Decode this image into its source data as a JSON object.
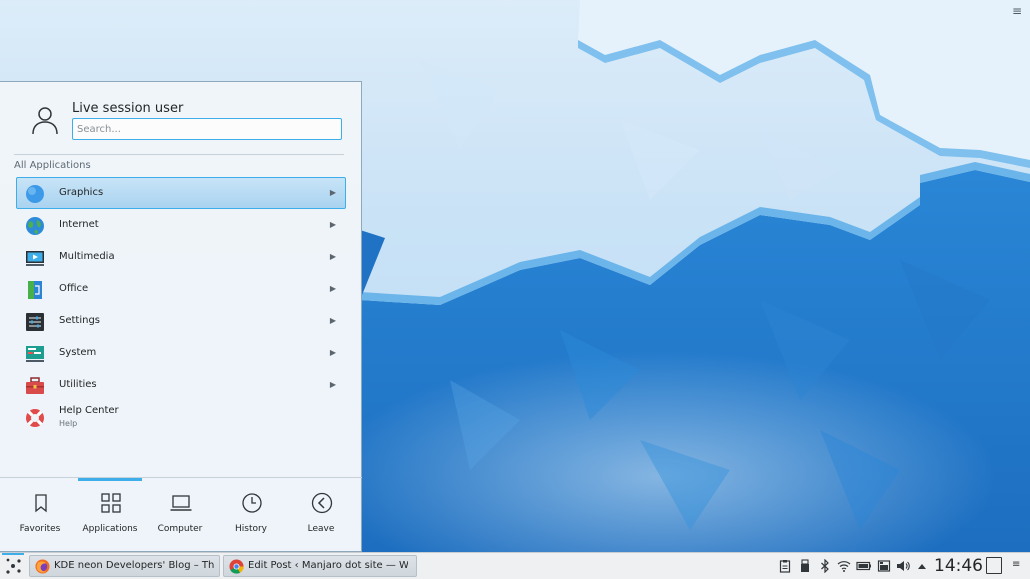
{
  "launcher": {
    "user_name": "Live session user",
    "search_placeholder": "Search...",
    "section_title": "All Applications",
    "apps": [
      {
        "label": "Graphics",
        "icon": "graphics-icon",
        "has_submenu": true,
        "selected": true
      },
      {
        "label": "Internet",
        "icon": "internet-globe-icon",
        "has_submenu": true
      },
      {
        "label": "Multimedia",
        "icon": "multimedia-icon",
        "has_submenu": true
      },
      {
        "label": "Office",
        "icon": "office-icon",
        "has_submenu": true
      },
      {
        "label": "Settings",
        "icon": "settings-sliders-icon",
        "has_submenu": true
      },
      {
        "label": "System",
        "icon": "system-monitor-icon",
        "has_submenu": true
      },
      {
        "label": "Utilities",
        "icon": "toolbox-icon",
        "has_submenu": true
      },
      {
        "label": "Help Center",
        "sublabel": "Help",
        "icon": "lifebuoy-icon",
        "has_submenu": false
      }
    ],
    "tabs": [
      {
        "label": "Favorites",
        "icon": "bookmark-icon"
      },
      {
        "label": "Applications",
        "icon": "grid-icon",
        "active": true
      },
      {
        "label": "Computer",
        "icon": "laptop-icon"
      },
      {
        "label": "History",
        "icon": "clock-icon"
      },
      {
        "label": "Leave",
        "icon": "back-arrow-icon"
      }
    ]
  },
  "taskbar": {
    "tasks": [
      {
        "label": "KDE neon Developers' Blog – The ...",
        "icon": "firefox-icon"
      },
      {
        "label": "Edit Post ‹ Manjaro dot site — Wor...",
        "icon": "chrome-icon"
      }
    ],
    "tray_icons": [
      "clipboard-icon",
      "usb-drive-icon",
      "bluetooth-icon",
      "wifi-icon",
      "battery-icon",
      "storage-icon",
      "volume-icon",
      "expand-tray-icon"
    ],
    "clock": "14:46"
  },
  "colors": {
    "accent": "#3daee9",
    "panel_bg": "#eff0f1",
    "desktop_dark": "#1e6fbe",
    "desktop_light": "#cfe6f8"
  }
}
